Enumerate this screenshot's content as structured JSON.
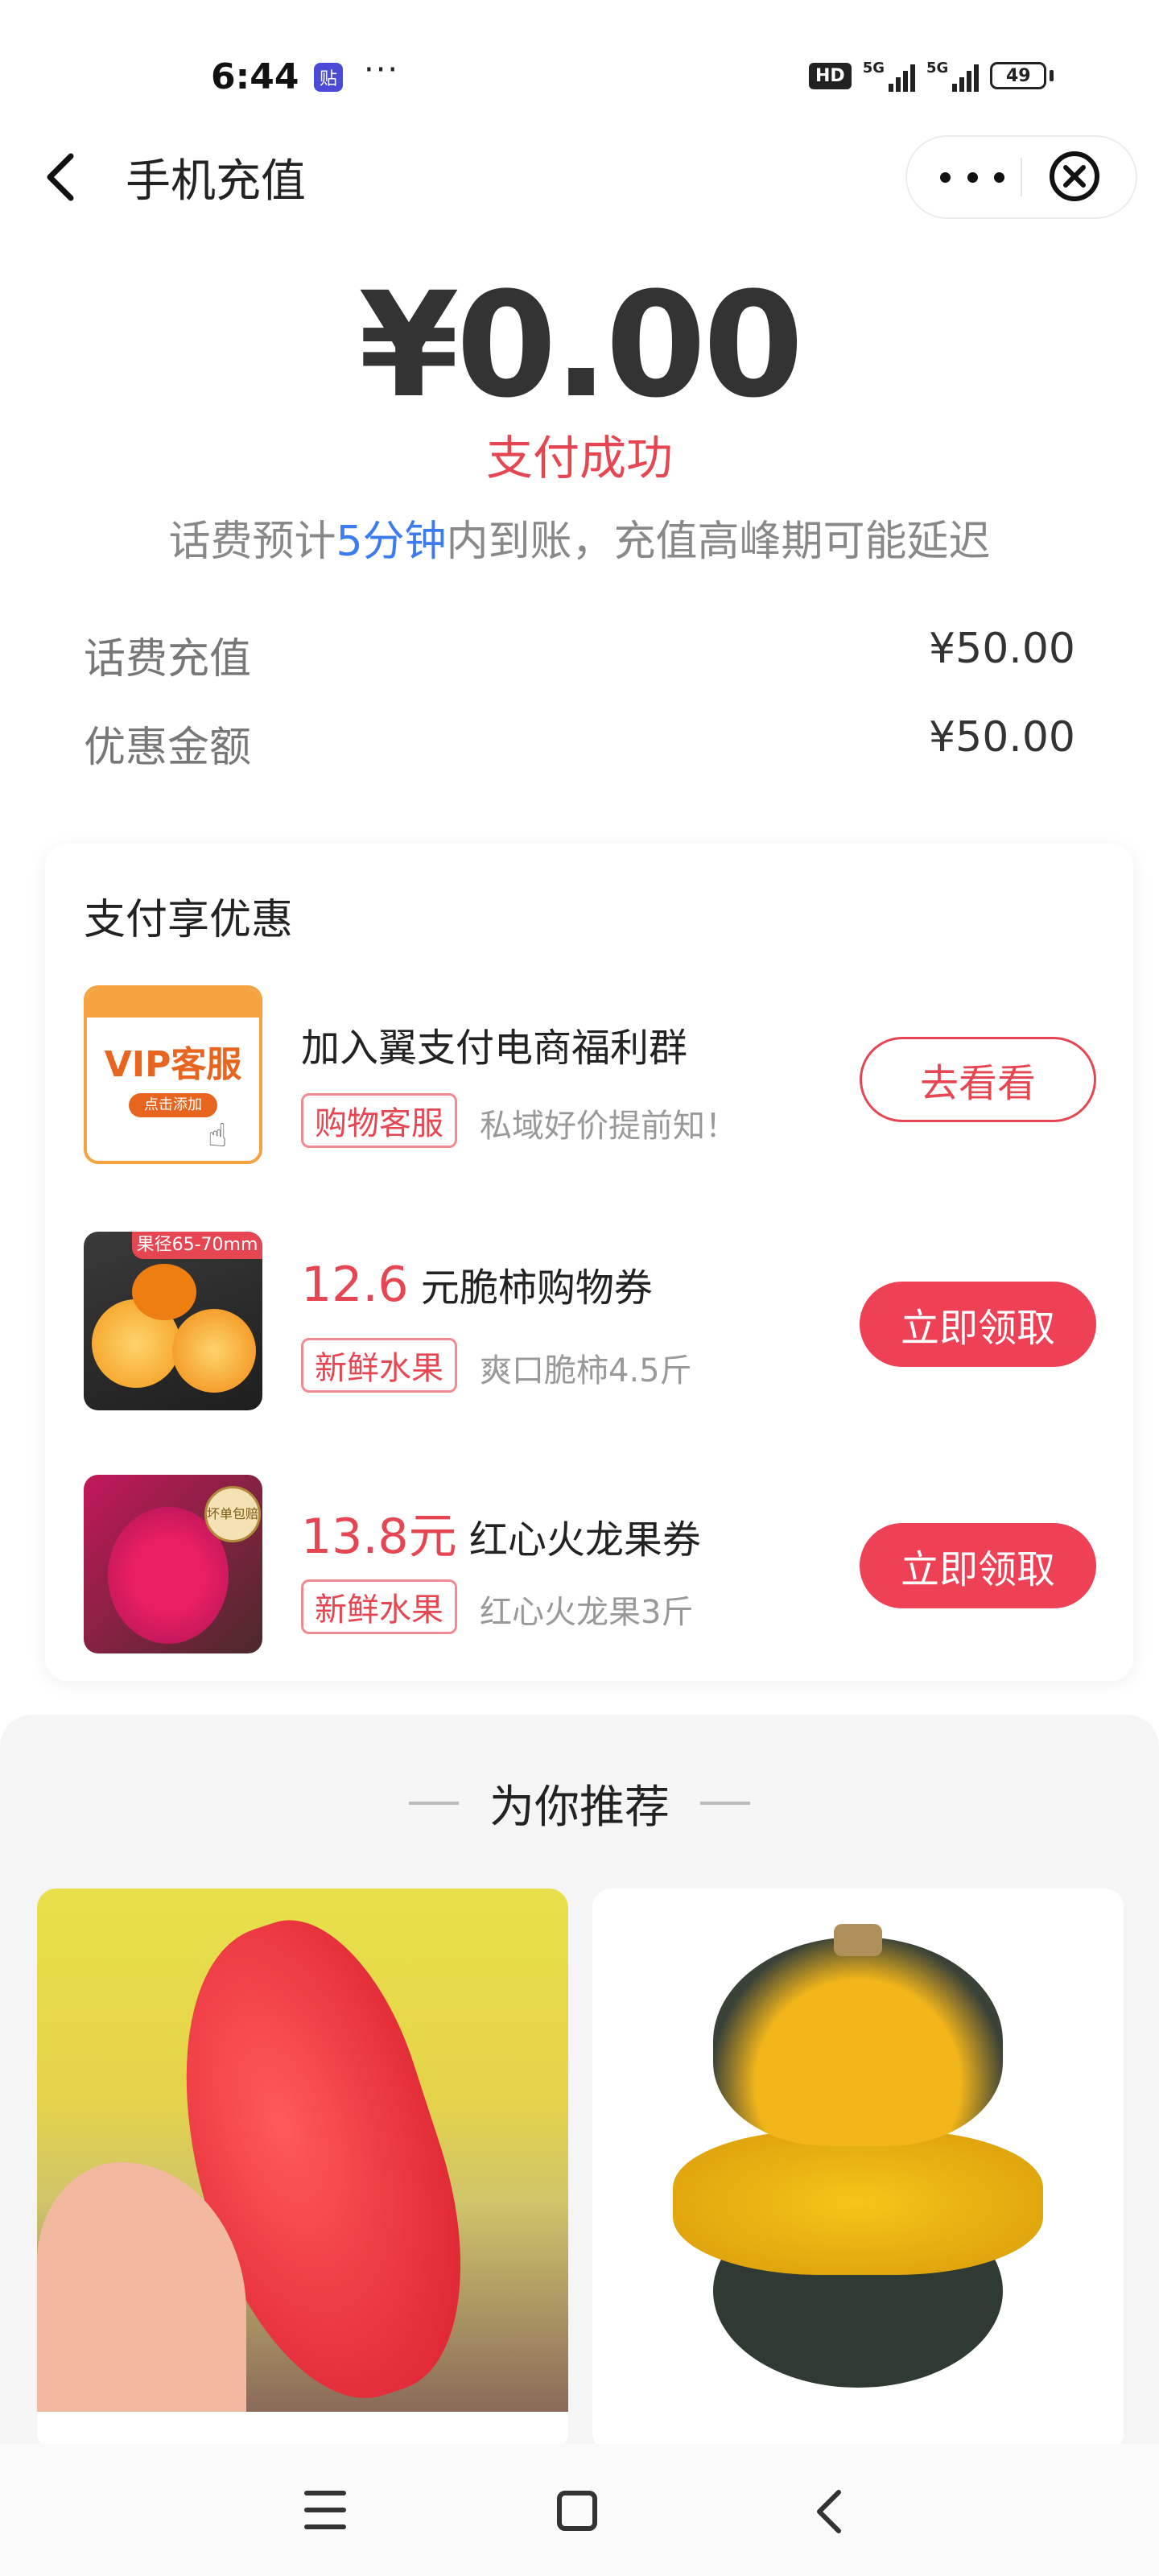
{
  "status_bar": {
    "time": "6:44",
    "badge": "贴",
    "dots": "···",
    "hd": "HD",
    "net1": "5G",
    "net2": "5G",
    "battery": "49"
  },
  "header": {
    "title": "手机充值",
    "back_icon": "chevron-left-icon",
    "more_icon": "more-dots-icon",
    "close_icon": "close-circle-icon"
  },
  "payment": {
    "amount": "¥0.00",
    "status": "支付成功",
    "notice_pre": "话费预计",
    "notice_highlight": "5分钟",
    "notice_post": "内到账，充值高峰期可能延迟",
    "highlight_color": "#3d7bf0",
    "status_color": "#e64652"
  },
  "details": [
    {
      "label": "话费充值",
      "value": "¥50.00"
    },
    {
      "label": "优惠金额",
      "value": "¥50.00"
    }
  ],
  "promo": {
    "title": "支付享优惠",
    "items": [
      {
        "thumb_text": "VIP客服",
        "thumb_sub": "点击添加",
        "title": "加入翼支付电商福利群",
        "tag": "购物客服",
        "desc": "私域好价提前知！",
        "button": "去看看"
      },
      {
        "thumb_text": "果径65-70mm",
        "price": "12.6",
        "title": " 元脆柿购物券",
        "tag": "新鲜水果",
        "desc": "爽口脆柿4.5斤",
        "button": "立即领取"
      },
      {
        "thumb_text": "坏单包赔",
        "price": "13.8元",
        "title": " 红心火龙果券",
        "tag": "新鲜水果",
        "desc": "红心火龙果3斤",
        "button": "立即领取"
      }
    ]
  },
  "recommend": {
    "title": "为你推荐",
    "products": [
      "pomelo-image",
      "pumpkin-image"
    ]
  },
  "navbar": {
    "menu_icon": "menu-icon",
    "home_icon": "home-icon",
    "back_icon": "back-icon"
  }
}
